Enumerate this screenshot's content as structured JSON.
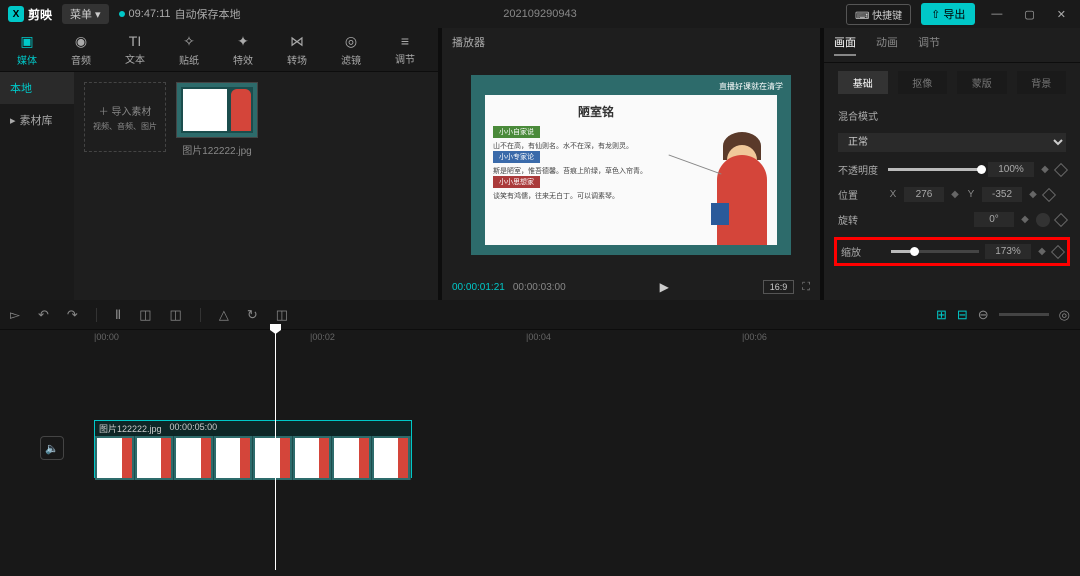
{
  "topbar": {
    "app_name": "剪映",
    "menu_label": "菜单",
    "autosave_time": "09:47:11",
    "autosave_text": "自动保存本地",
    "project_title": "202109290943",
    "shortcut_label": "⌨ 快捷键",
    "export_label": "导出"
  },
  "tabs": {
    "media": "媒体",
    "audio": "音频",
    "text": "文本",
    "sticker": "贴纸",
    "effect": "特效",
    "transition": "转场",
    "filter": "滤镜",
    "adjust": "调节"
  },
  "sidenav": {
    "local": "本地",
    "library": "素材库"
  },
  "import": {
    "title": "导入素材",
    "subtitle": "视频、音频、图片"
  },
  "media": {
    "item1_name": "图片122222.jpg"
  },
  "preview": {
    "header": "播放器",
    "watermark": "直播好课就在清学",
    "slide_title": "陋室铭",
    "bullet1_tag": "小小自家说",
    "bullet1_text": "山不在高，有仙则名。水不在深，有龙则灵。",
    "bullet2_tag": "小小专家论",
    "bullet2_text": "斯是陋室，惟吾德馨。苔痕上阶绿，草色入帘青。",
    "bullet3_tag": "小小思想家",
    "bullet3_text": "谈笑有鸿儒，往来无白丁。可以调素琴。",
    "time_current": "00:00:01:21",
    "time_total": "00:00:03:00",
    "ratio": "16:9"
  },
  "rpanel": {
    "tab_canvas": "画面",
    "tab_anim": "动画",
    "tab_adjust": "调节",
    "sub_basic": "基础",
    "sub_cutout": "抠像",
    "sub_mask": "蒙版",
    "sub_bg": "背景",
    "blend_label": "混合模式",
    "blend_value": "正常",
    "opacity_label": "不透明度",
    "opacity_value": "100%",
    "pos_label": "位置",
    "pos_x": "276",
    "pos_y": "-352",
    "rotate_label": "旋转",
    "rotate_value": "0°",
    "scale_label": "缩放",
    "scale_value": "173%"
  },
  "timeline": {
    "t0": "|00:00",
    "t1": "|00:02",
    "t2": "|00:04",
    "t3": "|00:06",
    "clip_name": "图片122222.jpg",
    "clip_dur": "00:00:05:00"
  }
}
